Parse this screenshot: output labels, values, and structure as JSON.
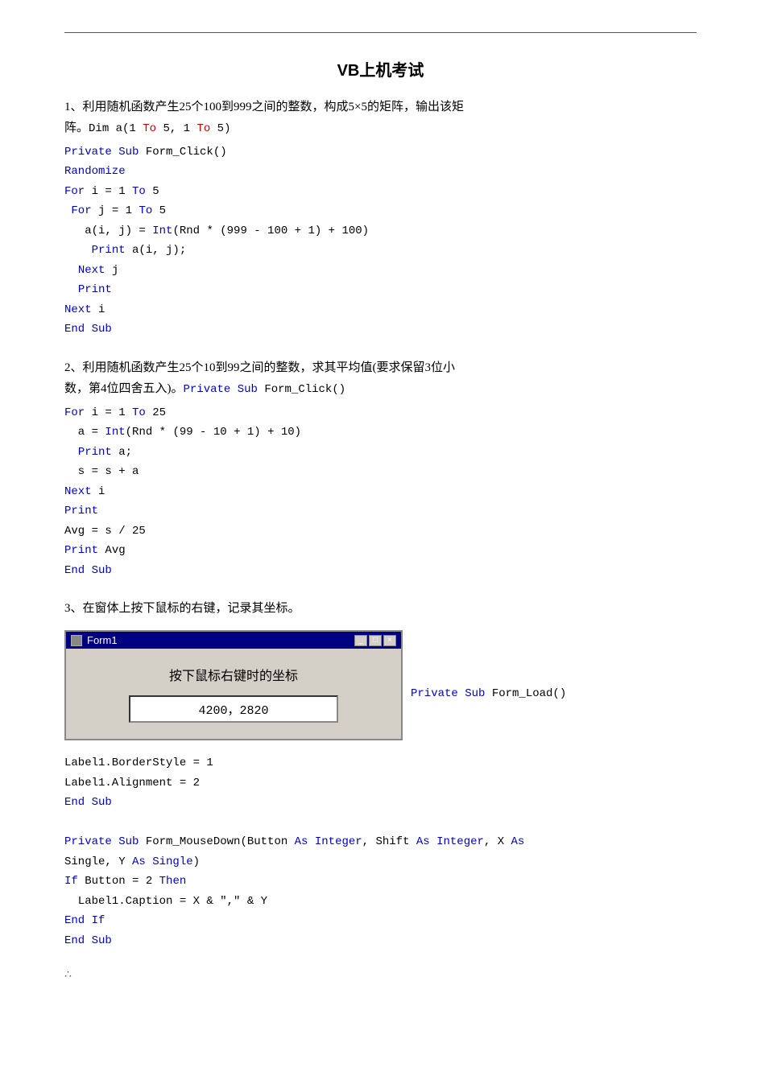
{
  "page": {
    "top_line": true,
    "title": "VB上机考试",
    "sections": [
      {
        "id": "section1",
        "desc": "1、利用随机函数产生25个100到999之间的整数，构成5×5的矩阵，输出该矩阵。Dim a(1 To 5, 1 To 5)",
        "code_lines": [
          "Private Sub Form_Click()",
          "Randomize",
          "For i = 1 To 5",
          " For j = 1 To 5",
          "   a(i, j) = Int(Rnd * (999 - 100 + 1) + 100)",
          "    Print a(i, j);",
          "  Next j",
          "  Print",
          "Next i",
          "End Sub"
        ]
      },
      {
        "id": "section2",
        "desc": "2、利用随机函数产生25个10到99之间的整数，求其平均值(要求保留3位小数，第4位四舍五入)。Private Sub Form_Click()",
        "code_lines": [
          "For i = 1 To 25",
          "  a = Int(Rnd * (99 - 10 + 1) + 10)",
          "  Print a;",
          "  s = s + a",
          "Next i",
          "Print",
          "Avg = s / 25",
          "Print Avg",
          "End Sub"
        ]
      },
      {
        "id": "section3",
        "desc": "3、在窗体上按下鼠标的右键，记录其坐标。",
        "window": {
          "title": "Form1",
          "label": "按下鼠标右键时的坐标",
          "value": "4200，2820"
        },
        "after_window_code": "Private Sub Form_Load()",
        "code_lines_after": [
          "Label1.BorderStyle = 1",
          "Label1.Alignment = 2",
          "End Sub",
          "",
          "Private Sub Form_MouseDown(Button As Integer, Shift As Integer, X As",
          "Single, Y As Single)",
          "If Button = 2 Then",
          "  Label1.Caption = X & \",\" & Y",
          "End If",
          "End Sub"
        ]
      }
    ],
    "footer": "∴"
  }
}
